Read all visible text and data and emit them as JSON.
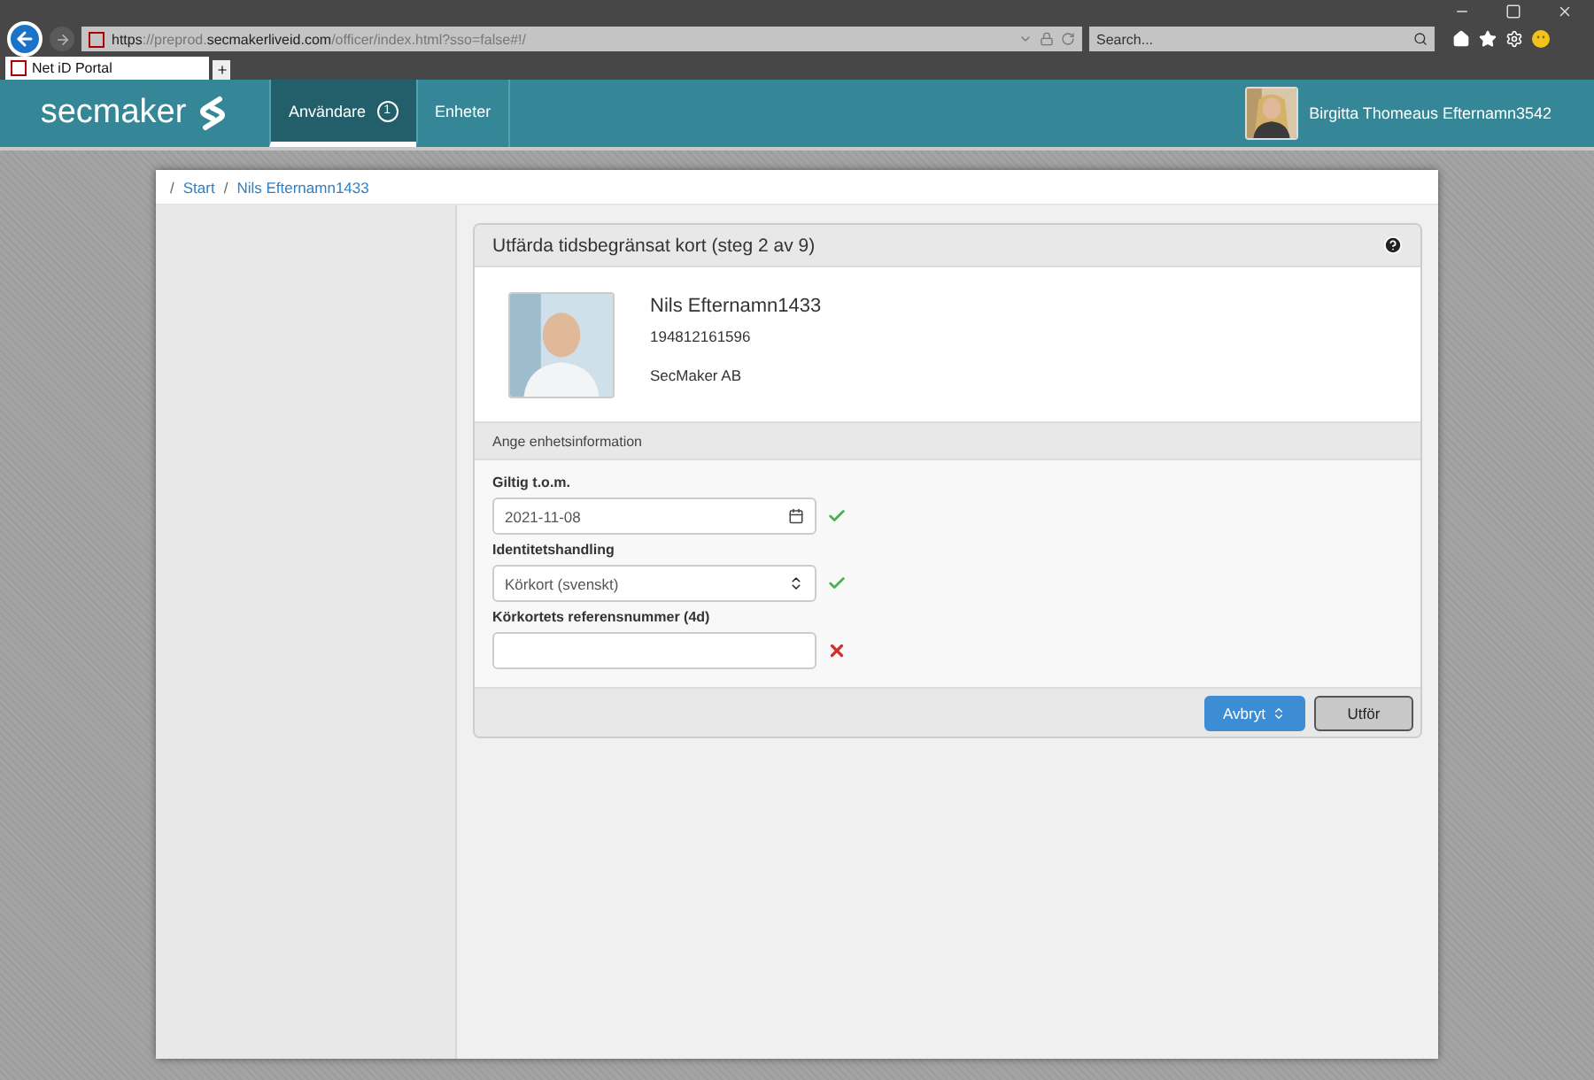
{
  "browser": {
    "url": "**https**://preprod.**secmakerliveid.com**/officer/index.html?sso=false#!/",
    "search": {
      "placeholder": "Search..."
    },
    "tabs": [
      {
        "label": "Net iD Portal",
        "selected": true
      }
    ]
  },
  "header": {
    "logo": "secmaker",
    "nav": [
      {
        "label": "Användare",
        "badge": "1",
        "selected": true
      },
      {
        "label": "Enheter",
        "selected": false
      }
    ],
    "user": {
      "name": "Birgitta Thomeaus Efternamn3542"
    }
  },
  "breadcrumb": [
    {
      "separator": "/",
      "label": "Start"
    },
    {
      "separator": "/",
      "label": "Nils Efternamn1433"
    }
  ],
  "panel": {
    "title": "Utfärda tidsbegränsat kort (steg 2 av 9)",
    "person": {
      "name": "Nils Efternamn1433",
      "id": "194812161596",
      "org": "SecMaker AB"
    },
    "section": "Ange enhetsinformation",
    "fields": [
      {
        "kind": "date",
        "label": "Giltig t.o.m.",
        "value": "2021-11-08",
        "valid": true
      },
      {
        "kind": "select",
        "label": "Identitetshandling",
        "value": "Körkort (svenskt)",
        "valid": true
      },
      {
        "kind": "text",
        "label": "Körkortets referensnummer (4d)",
        "valid": false
      }
    ],
    "buttons": [
      {
        "label": "Avbryt",
        "kind": "primary"
      },
      {
        "label": "Utför",
        "kind": "default"
      }
    ]
  }
}
